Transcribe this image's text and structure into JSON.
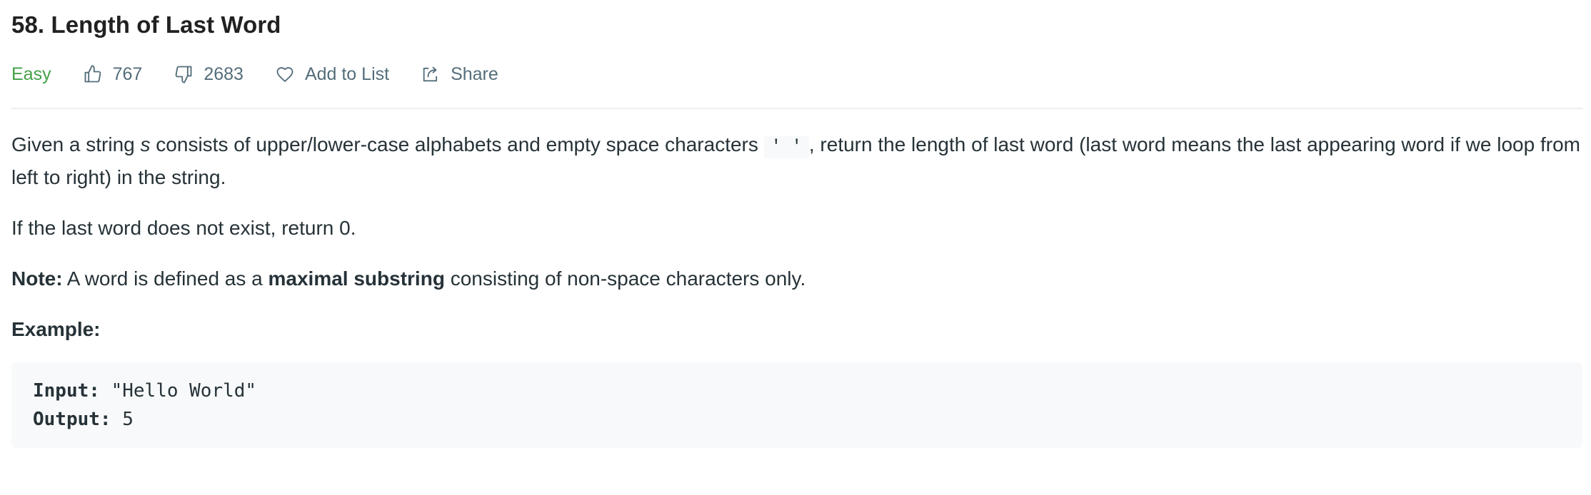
{
  "problem": {
    "title": "58. Length of Last Word",
    "difficulty": "Easy",
    "likes": "767",
    "dislikes": "2683",
    "add_to_list_label": "Add to List",
    "share_label": "Share"
  },
  "description": {
    "p1_before": "Given a string ",
    "p1_var": "s",
    "p1_middle": " consists of upper/lower-case alphabets and empty space characters ",
    "p1_code": "' '",
    "p1_after": ", return the length of last word (last word means the last appearing word if we loop from left to right) in the string.",
    "p2": "If the last word does not exist, return 0.",
    "note_label": "Note:",
    "note_before": " A word is defined as a ",
    "note_bold": "maximal substring",
    "note_after": " consisting of non-space characters only.",
    "example_heading": "Example:"
  },
  "example": {
    "input_label": "Input:",
    "input_value": " \"Hello World\"",
    "output_label": "Output:",
    "output_value": " 5"
  },
  "colors": {
    "difficulty_easy": "#43a047",
    "meta_text": "#546e7a",
    "code_bg": "#f7f9fa"
  },
  "icons": {
    "like": "thumbs-up-icon",
    "dislike": "thumbs-down-icon",
    "add_to_list": "heart-icon",
    "share": "share-icon"
  }
}
